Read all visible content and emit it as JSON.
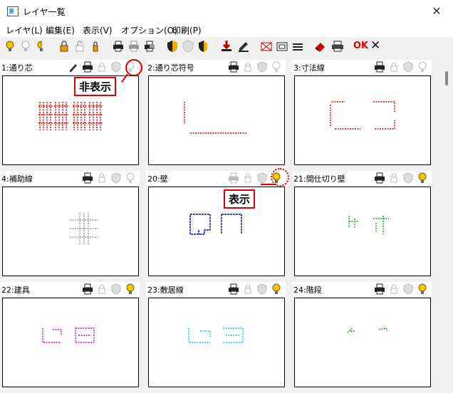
{
  "window": {
    "title": "レイヤ一覧",
    "close_glyph": "✕"
  },
  "menu": [
    {
      "label": "レイヤ(L)"
    },
    {
      "label": "編集(E)"
    },
    {
      "label": "表示(V)"
    },
    {
      "label": "オプション(O)"
    },
    {
      "label": "印刷(P)"
    }
  ],
  "toolbar": {
    "buttons": [
      "bulb-on-icon",
      "bulb-off-icon",
      "bulb-half-icon",
      "lock-icon",
      "lock-open-icon",
      "lock-half-icon",
      "printer-icon",
      "printer-off-icon",
      "printer-half-icon",
      "shield-icon",
      "shield-off-icon",
      "shield-half-icon",
      "download-icon",
      "edit-icon",
      "frame-icon",
      "rect-icon",
      "layers-icon",
      "eraser-icon",
      "print-icon"
    ],
    "ok_label": "OK",
    "cancel_glyph": "✕"
  },
  "panels": [
    {
      "name": "1:通り芯",
      "bulb": "off",
      "pencil": true,
      "color": "#d00000"
    },
    {
      "name": "2:通り芯符号",
      "bulb": "off",
      "pencil": false,
      "color": "#d00000"
    },
    {
      "name": "3:寸法線",
      "bulb": "off",
      "pencil": false,
      "color": "#d00000"
    },
    {
      "name": "4:補助線",
      "bulb": "off",
      "pencil": false,
      "color": "#999999"
    },
    {
      "name": "20:壁",
      "bulb": "on",
      "pencil": false,
      "color": "#0000c0"
    },
    {
      "name": "21:間仕切り壁",
      "bulb": "on",
      "pencil": false,
      "color": "#00b000"
    },
    {
      "name": "22:建具",
      "bulb": "on",
      "pencil": false,
      "color": "#c000c0"
    },
    {
      "name": "23:敷居線",
      "bulb": "on",
      "pencil": false,
      "color": "#00c8d0"
    },
    {
      "name": "24:階段",
      "bulb": "on",
      "pencil": false,
      "color": "#00a000"
    }
  ],
  "callouts": {
    "hidden": "非表示",
    "shown": "表示"
  },
  "colors": {
    "annotation": "#e00000",
    "bulb_on": "#f5c400"
  }
}
